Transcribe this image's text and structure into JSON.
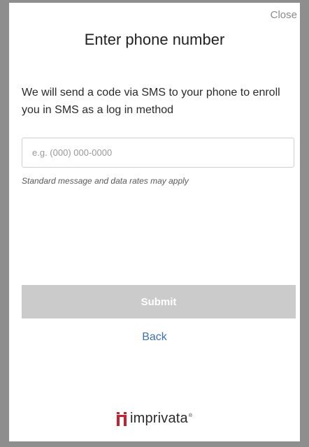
{
  "dialog": {
    "close_label": "Close",
    "title": "Enter phone number",
    "description": "We will send a code via SMS to your phone to enroll you in SMS as a log in method",
    "phone_input": {
      "value": "",
      "placeholder": "e.g. (000) 000-0000"
    },
    "rates_note": "Standard message and data rates may apply",
    "submit_label": "Submit",
    "back_label": "Back"
  },
  "branding": {
    "logo_text": "imprivata",
    "logo_trademark": "®",
    "logo_color": "#c8202f"
  },
  "colors": {
    "backdrop": "#8e8e8e",
    "link": "#3f6fb6",
    "submit_disabled": "#cbcbcb"
  }
}
